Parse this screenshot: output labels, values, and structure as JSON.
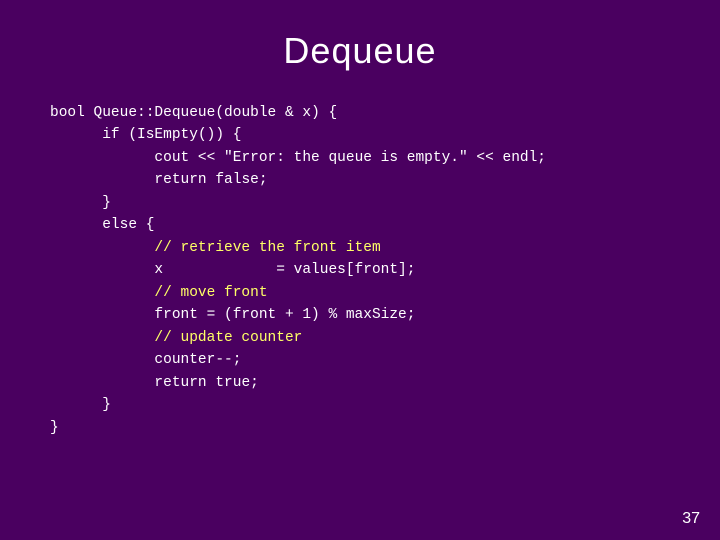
{
  "slide": {
    "title": "Dequeue",
    "slide_number": "37",
    "code": {
      "lines": [
        {
          "id": "l1",
          "text": "bool Queue::Dequeue(double & x) {",
          "type": "normal"
        },
        {
          "id": "l2",
          "text": "      if (IsEmpty()) {",
          "type": "normal"
        },
        {
          "id": "l3",
          "text": "            cout << \"Error: the queue is empty.\" << endl;",
          "type": "normal"
        },
        {
          "id": "l4",
          "text": "            return false;",
          "type": "normal"
        },
        {
          "id": "l5",
          "text": "      }",
          "type": "normal"
        },
        {
          "id": "l6",
          "text": "      else {",
          "type": "normal"
        },
        {
          "id": "l7",
          "text": "            // retrieve the front item",
          "type": "comment"
        },
        {
          "id": "l8",
          "text": "            x             = values[front];",
          "type": "normal"
        },
        {
          "id": "l9",
          "text": "            // move front",
          "type": "comment"
        },
        {
          "id": "l10",
          "text": "            front = (front + 1) % maxSize;",
          "type": "normal"
        },
        {
          "id": "l11",
          "text": "            // update counter",
          "type": "comment"
        },
        {
          "id": "l12",
          "text": "            counter--;",
          "type": "normal"
        },
        {
          "id": "l13",
          "text": "            return true;",
          "type": "normal"
        },
        {
          "id": "l14",
          "text": "      }",
          "type": "normal"
        },
        {
          "id": "l15",
          "text": "}",
          "type": "normal"
        }
      ]
    }
  }
}
